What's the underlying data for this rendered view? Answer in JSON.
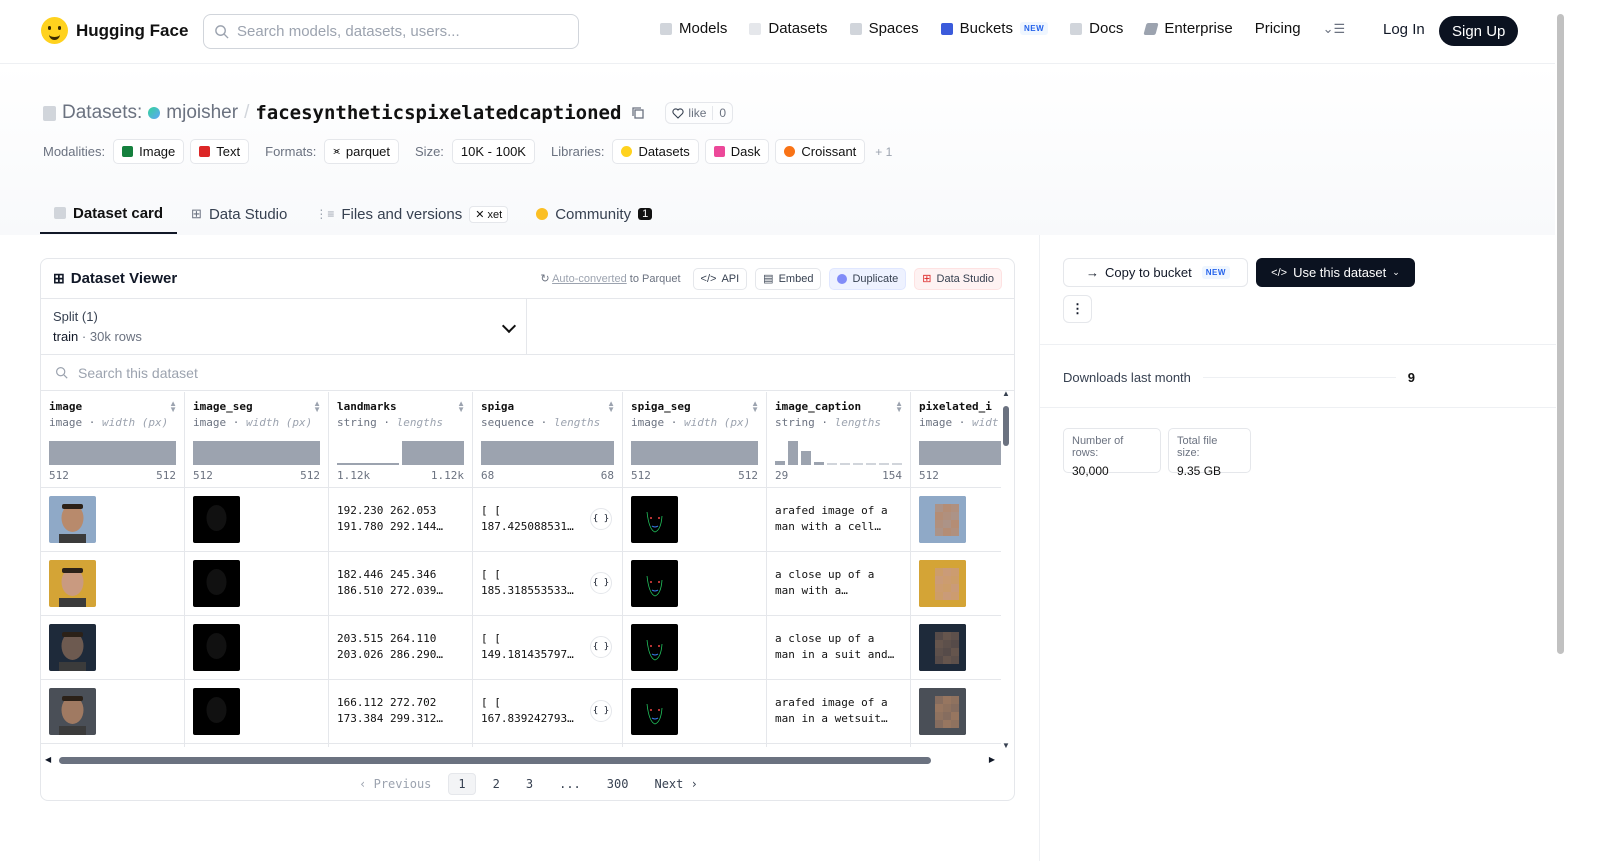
{
  "nav": {
    "brand": "Hugging Face",
    "search_placeholder": "Search models, datasets, users...",
    "links": [
      "Models",
      "Datasets",
      "Spaces",
      "Buckets",
      "Docs",
      "Enterprise",
      "Pricing"
    ],
    "new_badge": "NEW",
    "login": "Log In",
    "signup": "Sign Up"
  },
  "repo": {
    "section": "Datasets:",
    "owner": "mjoisher",
    "sep": "/",
    "name": "facesyntheticspixelatedcaptioned",
    "like_label": "like",
    "like_count": "0"
  },
  "tags": {
    "modalities_label": "Modalities:",
    "modalities": [
      "Image",
      "Text"
    ],
    "formats_label": "Formats:",
    "format": "parquet",
    "size_label": "Size:",
    "size": "10K - 100K",
    "libraries_label": "Libraries:",
    "libraries": [
      "Datasets",
      "Dask",
      "Croissant"
    ],
    "more": "+ 1"
  },
  "tabs": [
    "Dataset card",
    "Data Studio",
    "Files and versions",
    "Community"
  ],
  "tab_badges": {
    "xet": "xet",
    "community_count": "1"
  },
  "viewer": {
    "title": "Dataset Viewer",
    "auto_converted": "Auto-converted",
    "to_parquet": "to Parquet",
    "actions": [
      "API",
      "Embed",
      "Duplicate",
      "Data Studio"
    ],
    "split_label": "Split (1)",
    "split_name": "train",
    "split_rows": "30k rows",
    "search_placeholder": "Search this dataset",
    "columns": [
      {
        "name": "image",
        "type": "image",
        "stat": "width (px)",
        "min": "512",
        "max": "512"
      },
      {
        "name": "image_seg",
        "type": "image",
        "stat": "width (px)",
        "min": "512",
        "max": "512"
      },
      {
        "name": "landmarks",
        "type": "string",
        "stat": "lengths",
        "min": "1.12k",
        "max": "1.12k"
      },
      {
        "name": "spiga",
        "type": "sequence",
        "stat": "lengths",
        "min": "68",
        "max": "68"
      },
      {
        "name": "spiga_seg",
        "type": "image",
        "stat": "width (px)",
        "min": "512",
        "max": "512"
      },
      {
        "name": "image_caption",
        "type": "string",
        "stat": "lengths",
        "min": "29",
        "max": "154"
      },
      {
        "name": "pixelated_i",
        "type": "image",
        "stat": "widt",
        "min": "512",
        "max": ""
      }
    ],
    "caption_hist": [
      0.15,
      1.0,
      0.6,
      0.12,
      0.05,
      0.05,
      0.05,
      0.05,
      0.05,
      0.05
    ],
    "landmarks_hist": [
      0.05,
      1.0
    ],
    "rows": [
      {
        "landmarks": "192.230 262.053\n191.780 292.144…",
        "spiga": "[ [\n187.425088531…",
        "caption": "arafed image of a\nman with a cell…",
        "skin": "#b88a6c",
        "bg": "#8fa9c7"
      },
      {
        "landmarks": "182.446 245.346\n186.510 272.039…",
        "spiga": "[ [\n185.318553533…",
        "caption": "a close up of a\nman with a…",
        "skin": "#c99a80",
        "bg": "#d4a436"
      },
      {
        "landmarks": "203.515 264.110\n203.026 286.290…",
        "spiga": "[ [\n149.181435797…",
        "caption": "a close up of a\nman in a suit and…",
        "skin": "#6d5a50",
        "bg": "#1e2a3a"
      },
      {
        "landmarks": "166.112 272.702\n173.384 299.312…",
        "spiga": "[ [\n167.839242793…",
        "caption": "arafed image of a\nman in a wetsuit…",
        "skin": "#a07a62",
        "bg": "#4a4f57"
      }
    ],
    "json_icon": "{ }",
    "pager": {
      "prev": "Previous",
      "pages": [
        "1",
        "2",
        "3",
        "...",
        "300"
      ],
      "next": "Next"
    }
  },
  "sidebar": {
    "copy_label": "Copy to bucket",
    "copy_badge": "NEW",
    "use_label": "Use this dataset",
    "more": "⋮",
    "downloads_label": "Downloads last month",
    "downloads": "9",
    "rows_label": "Number of rows:",
    "rows": "30,000",
    "size_label": "Total file size:",
    "size": "9.35 GB"
  },
  "colors": {
    "accent": "#0b1220",
    "hist": "#9ca3af",
    "border": "#e5e7eb"
  }
}
